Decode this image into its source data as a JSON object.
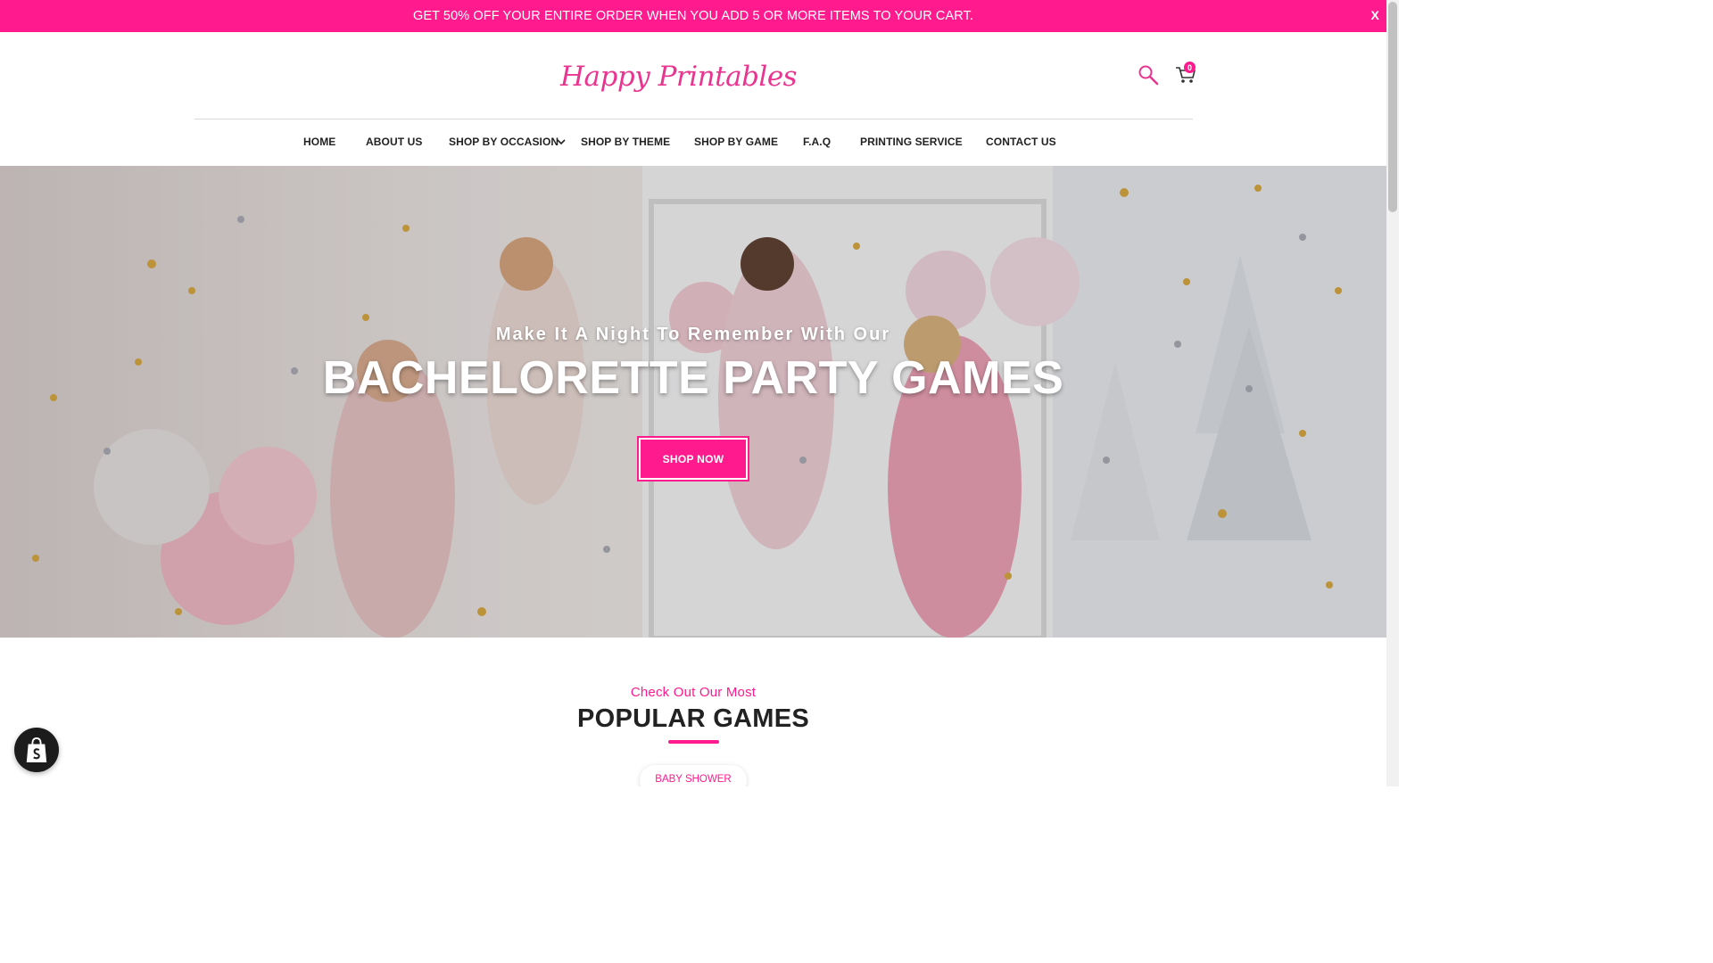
{
  "announcement": {
    "text": "GET 50% OFF YOUR ENTIRE ORDER WHEN YOU ADD 5 OR MORE ITEMS TO YOUR CART.",
    "close_label": "X"
  },
  "header": {
    "logo_text": "Happy Printables",
    "cart_count": "0",
    "icons": {
      "search": "search-icon",
      "cart": "cart-icon"
    }
  },
  "nav": {
    "items": [
      {
        "label": "HOME"
      },
      {
        "label": "ABOUT US"
      },
      {
        "label": "SHOP BY OCCASION"
      },
      {
        "label": "SHOP BY THEME"
      },
      {
        "label": "SHOP BY GAME"
      },
      {
        "label": "F.A.Q"
      },
      {
        "label": "PRINTING SERVICE"
      },
      {
        "label": "CONTACT US"
      }
    ]
  },
  "hero": {
    "subtitle": "Make It A Night To Remember With Our",
    "title": "BACHELORETTE PARTY GAMES",
    "button_label": "SHOP NOW"
  },
  "popular": {
    "subtitle": "Check Out Our Most",
    "title": "POPULAR GAMES",
    "tabs": [
      {
        "label": "BABY SHOWER"
      }
    ]
  },
  "colors": {
    "brand_pink": "#ff1b8d",
    "text_dark": "#222222"
  }
}
